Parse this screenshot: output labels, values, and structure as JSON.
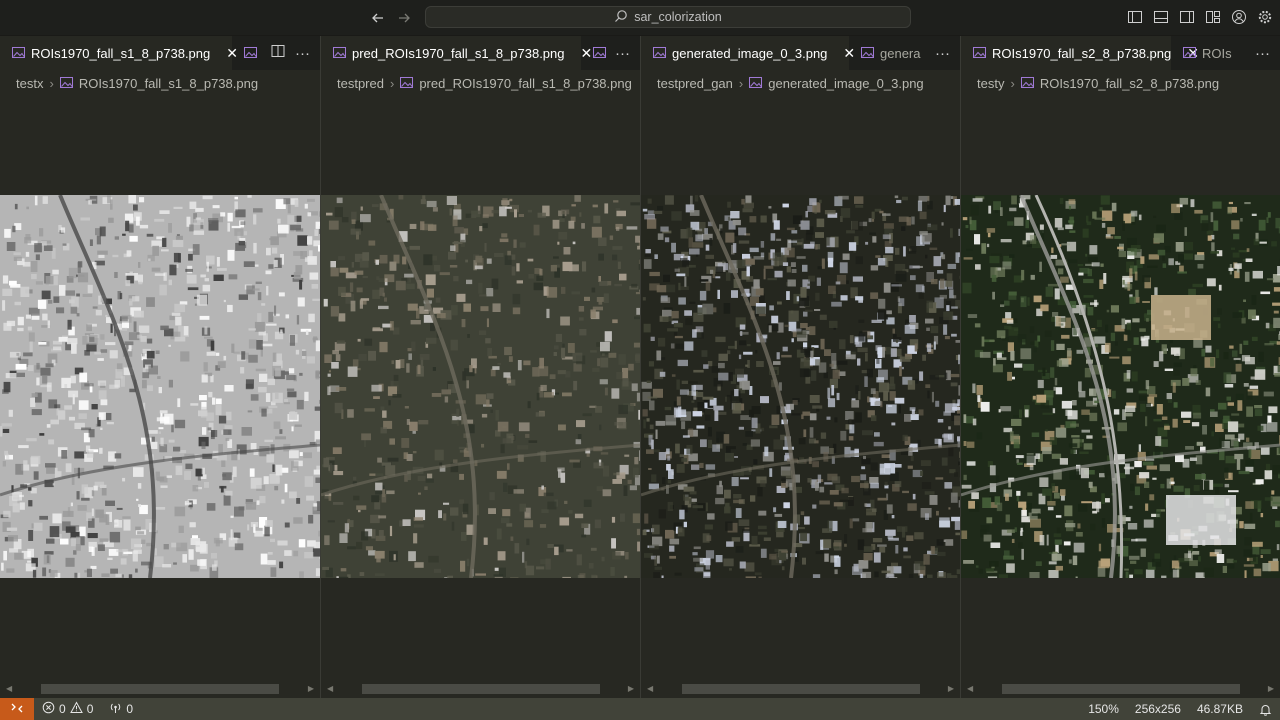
{
  "titlebar": {
    "search": "sar_colorization",
    "back_icon": "arrow-left-icon",
    "forward_icon": "arrow-right-icon"
  },
  "groups": [
    {
      "tabs": [
        {
          "label": "ROIs1970_fall_s1_8_p738.png",
          "active": true
        },
        {
          "label": ""
        }
      ],
      "breadcrumb": {
        "folder": "testx",
        "file": "ROIs1970_fall_s1_8_p738.png"
      },
      "image_kind": "sar-grayscale"
    },
    {
      "tabs": [
        {
          "label": "pred_ROIs1970_fall_s1_8_p738.png",
          "active": true
        },
        {
          "label": ""
        }
      ],
      "breadcrumb": {
        "folder": "testpred",
        "file": "pred_ROIs1970_fall_s1_8_p738.png"
      },
      "image_kind": "predicted-color"
    },
    {
      "tabs": [
        {
          "label": "generated_image_0_3.png",
          "active": true
        },
        {
          "label": "genera"
        }
      ],
      "breadcrumb": {
        "folder": "testpred_gan",
        "file": "generated_image_0_3.png"
      },
      "image_kind": "gan-generated"
    },
    {
      "tabs": [
        {
          "label": "ROIs1970_fall_s2_8_p738.png",
          "active": true
        },
        {
          "label": "ROIs"
        }
      ],
      "breadcrumb": {
        "folder": "testy",
        "file": "ROIs1970_fall_s2_8_p738.png"
      },
      "image_kind": "optical-ground-truth"
    }
  ],
  "statusbar": {
    "errors": "0",
    "warnings": "0",
    "ports": "0",
    "zoom": "150%",
    "dimensions": "256x256",
    "filesize": "46.87KB"
  },
  "colors": {
    "accent_remote": "#c75a1a",
    "statusbar": "#414339",
    "editor_bg": "#272822",
    "tab_bg": "#1e1f1c"
  }
}
